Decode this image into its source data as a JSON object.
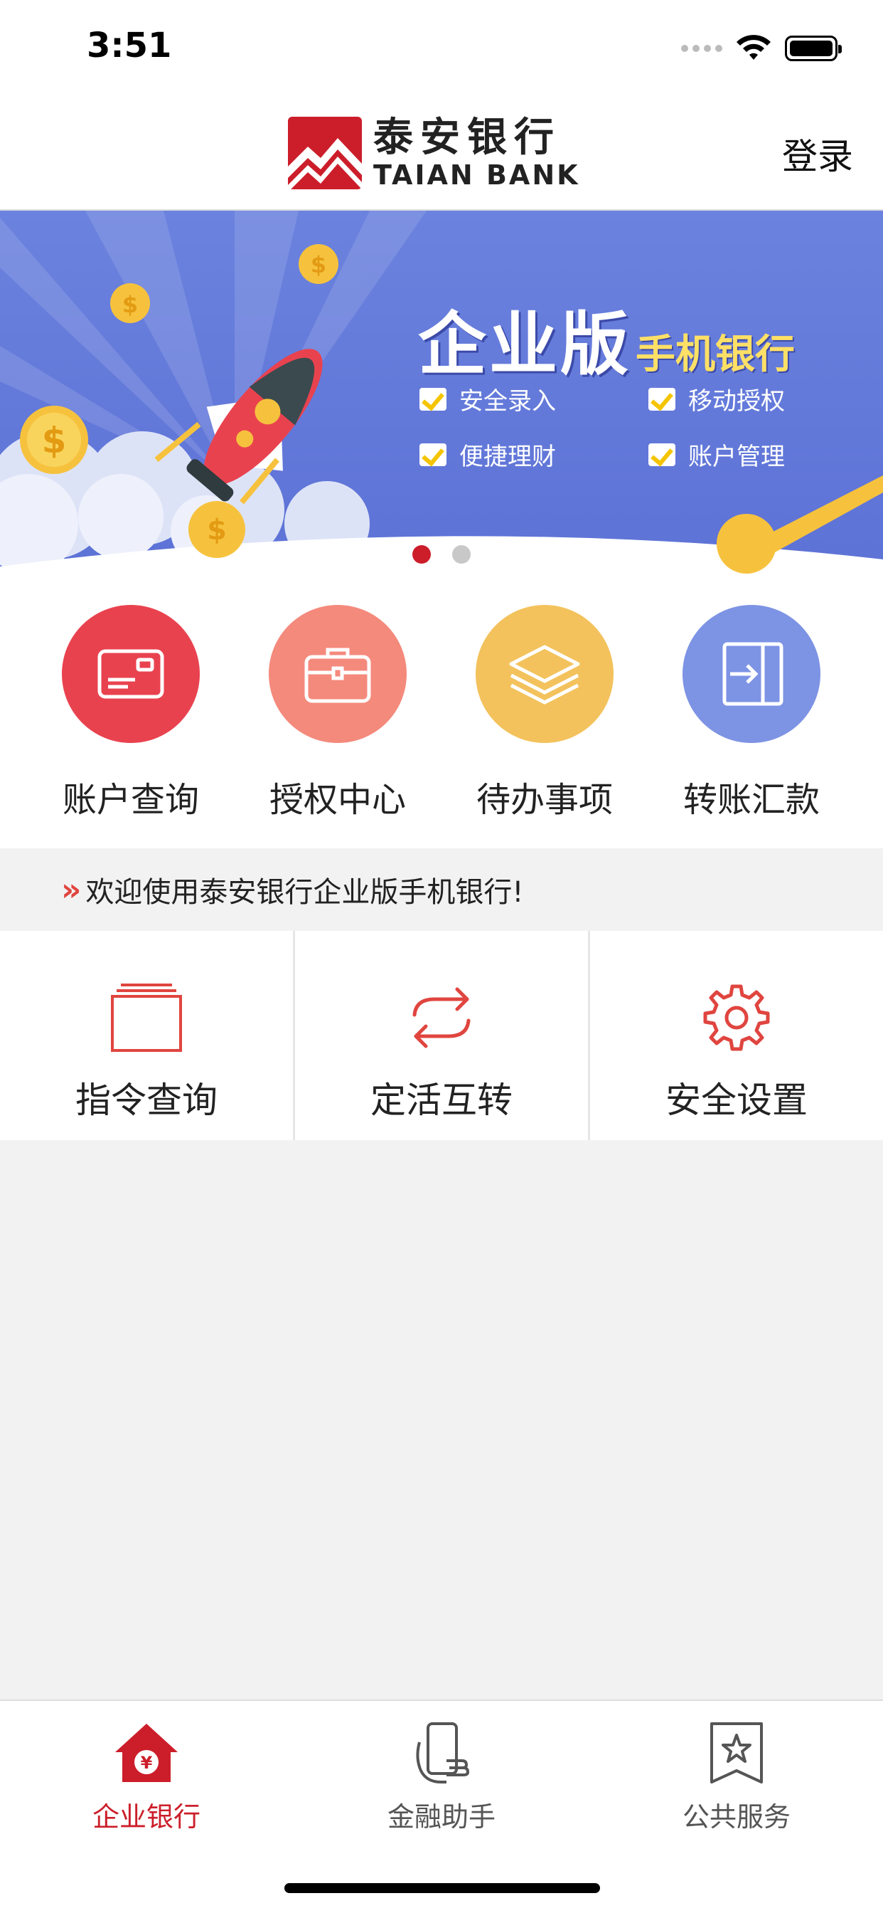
{
  "status_bar": {
    "time": "3:51"
  },
  "header": {
    "logo_cn": "泰安银行",
    "logo_en": "TAIAN BANK",
    "login_label": "登录",
    "brand_color": "#cc1e2a"
  },
  "banner": {
    "title_big": "企业版",
    "title_small": "手机银行",
    "features": [
      "安全录入",
      "移动授权",
      "便捷理财",
      "账户管理"
    ],
    "slides_count": 2,
    "active_slide": 1
  },
  "quick_menu": [
    {
      "label": "账户查询",
      "icon": "card-icon",
      "color": "#e9424f"
    },
    {
      "label": "授权中心",
      "icon": "briefcase-icon",
      "color": "#f48a7c"
    },
    {
      "label": "待办事项",
      "icon": "layers-icon",
      "color": "#f3c25c"
    },
    {
      "label": "转账汇款",
      "icon": "transfer-in-icon",
      "color": "#7d93e4"
    }
  ],
  "notice": {
    "text": "欢迎使用泰安银行企业版手机银行!"
  },
  "functions": [
    {
      "label": "指令查询",
      "icon": "stack-pages-icon"
    },
    {
      "label": "定活互转",
      "icon": "refresh-arrows-icon"
    },
    {
      "label": "安全设置",
      "icon": "gear-icon"
    }
  ],
  "tabbar": [
    {
      "label": "企业银行",
      "icon": "bank-home-icon",
      "active": true
    },
    {
      "label": "金融助手",
      "icon": "phone-hand-icon",
      "active": false
    },
    {
      "label": "公共服务",
      "icon": "bookmark-star-icon",
      "active": false
    }
  ]
}
